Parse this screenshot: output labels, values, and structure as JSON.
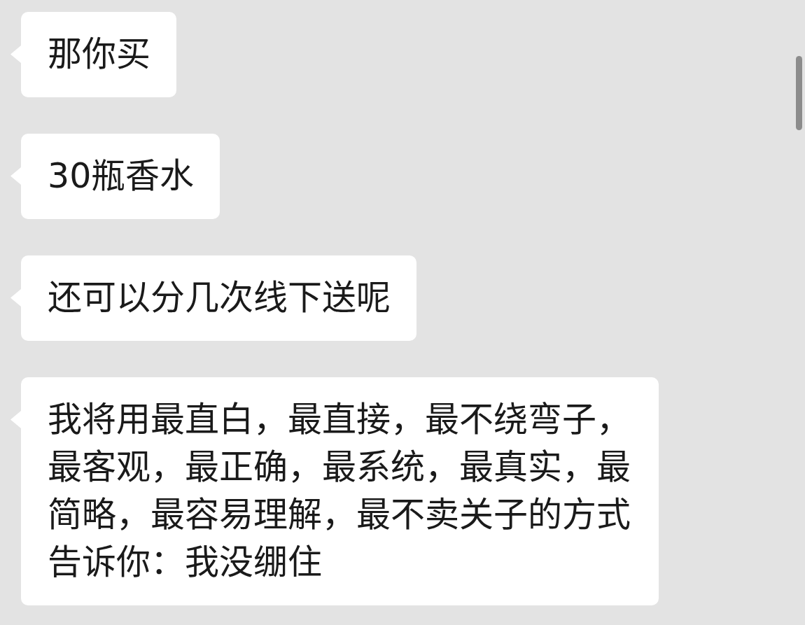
{
  "messages": [
    {
      "incoming": true,
      "text": "那你买"
    },
    {
      "incoming": true,
      "text": "30瓶香水"
    },
    {
      "incoming": true,
      "text": "还可以分几次线下送呢"
    },
    {
      "incoming": true,
      "text": "我将用最直白，最直接，最不绕弯子，最客观，最正确，最系统，最真实，最简略，最容易理解，最不卖关子的方式告诉你：我没绷住"
    }
  ]
}
